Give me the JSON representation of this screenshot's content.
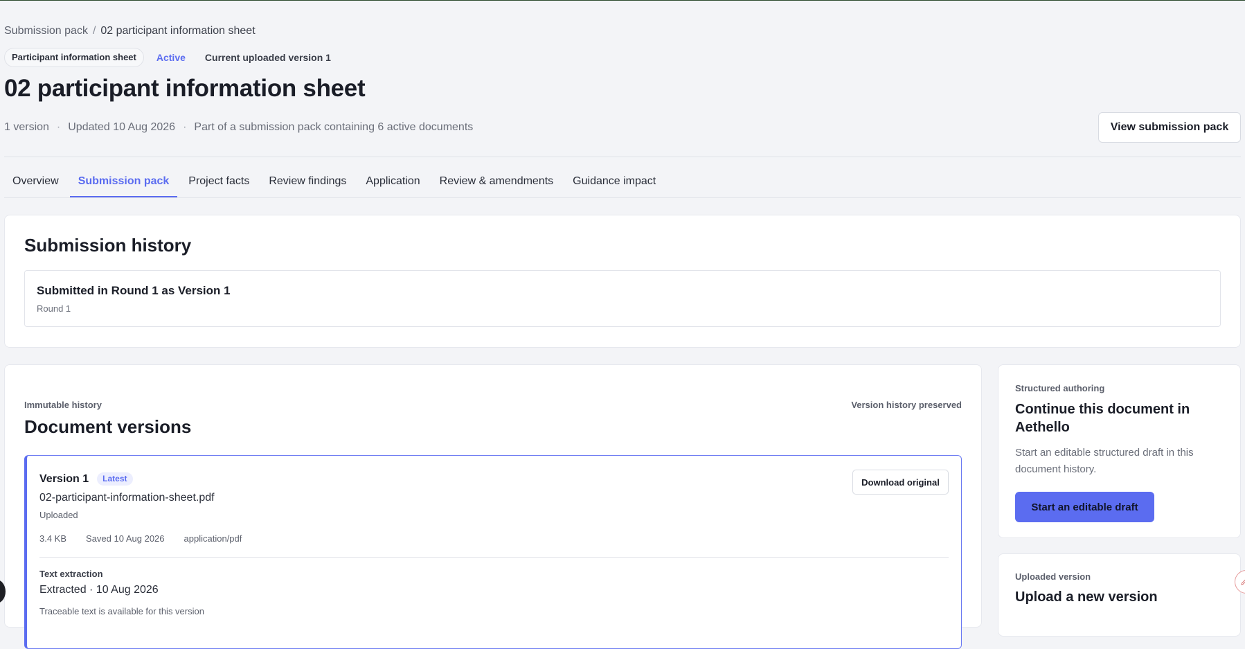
{
  "breadcrumb": {
    "parent": "Submission pack",
    "separator": "/",
    "current": "02 participant information sheet"
  },
  "document": {
    "type_badge": "Participant information sheet",
    "status": "Active",
    "current_version": "Current uploaded version 1",
    "title": "02 participant information sheet",
    "meta": {
      "versions": "1 version",
      "updated": "Updated 10 Aug 2026",
      "pack": "Part of a submission pack containing 6 active documents"
    },
    "view_pack_label": "View submission pack"
  },
  "tabs": [
    {
      "label": "Overview",
      "active": false
    },
    {
      "label": "Submission pack",
      "active": true
    },
    {
      "label": "Project facts",
      "active": false
    },
    {
      "label": "Review findings",
      "active": false
    },
    {
      "label": "Application",
      "active": false
    },
    {
      "label": "Review & amendments",
      "active": false
    },
    {
      "label": "Guidance impact",
      "active": false
    }
  ],
  "submission_history": {
    "title": "Submission history",
    "items": [
      {
        "title": "Submitted in Round 1 as Version 1",
        "subtitle": "Round 1"
      }
    ]
  },
  "versions": {
    "eyebrow": "Immutable history",
    "preserved": "Version history preserved",
    "title": "Document versions",
    "items": [
      {
        "label": "Version 1",
        "badge": "Latest",
        "filename": "02-participant-information-sheet.pdf",
        "status": "Uploaded",
        "size": "3.4 KB",
        "saved": "Saved 10 Aug 2026",
        "mime": "application/pdf",
        "download_label": "Download original",
        "extraction_label": "Text extraction",
        "extraction_value": "Extracted · 10 Aug 2026",
        "extraction_note": "Traceable text is available for this version"
      }
    ]
  },
  "authoring": {
    "eyebrow": "Structured authoring",
    "title": "Continue this document in Aethello",
    "description": "Start an editable structured draft in this document history.",
    "button_label": "Start an editable draft"
  },
  "upload": {
    "eyebrow": "Uploaded version",
    "title": "Upload a new version"
  },
  "colors": {
    "accent": "#5b6cf0",
    "background": "#f3f4f7",
    "card": "#ffffff",
    "text": "#1a1d27",
    "muted": "#6a6e79"
  }
}
